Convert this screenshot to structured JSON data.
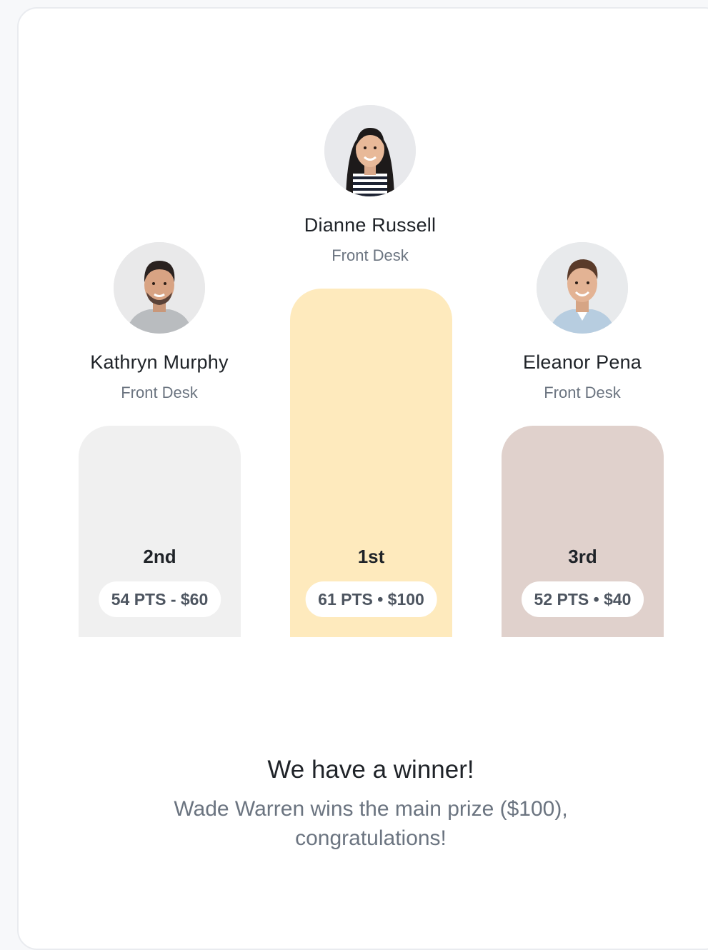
{
  "leaderboard": {
    "first": {
      "name": "Dianne Russell",
      "role": "Front Desk",
      "rank": "1st",
      "score_prize": "61 PTS • $100",
      "avatar_icon": "woman-portrait-avatar",
      "podium_color": "#feeabd"
    },
    "second": {
      "name": "Kathryn Murphy",
      "role": "Front Desk",
      "rank": "2nd",
      "score_prize": "54 PTS - $60",
      "avatar_icon": "man-portrait-avatar",
      "podium_color": "#f0f0f0"
    },
    "third": {
      "name": "Eleanor Pena",
      "role": "Front Desk",
      "rank": "3rd",
      "score_prize": "52 PTS • $40",
      "avatar_icon": "man-portrait-avatar",
      "podium_color": "#e0d1cc"
    }
  },
  "announcement": {
    "headline": "We have a winner!",
    "message_line1": "Wade Warren wins the main prize ($100),",
    "message_line2": "congratulations!"
  }
}
